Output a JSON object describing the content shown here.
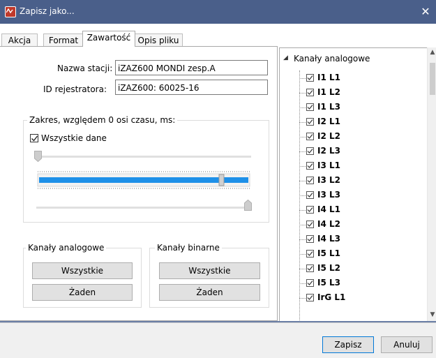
{
  "window": {
    "title": "Zapisz jako...",
    "close_glyph": "✕"
  },
  "tabs": [
    {
      "label": "Akcja"
    },
    {
      "label": "Format"
    },
    {
      "label": "Zawartość",
      "active": true
    },
    {
      "label": "Opis pliku"
    }
  ],
  "station": {
    "name_label": "Nazwa stacji:",
    "name_value": "iZAZ600 MONDI zesp.A",
    "recorder_label": "ID rejestratora:",
    "recorder_value": "iZAZ600: 60025-16"
  },
  "range": {
    "title": "Zakres, względem 0 osi czasu, ms:",
    "all_data_label": "Wszystkie dane",
    "all_data_checked": true
  },
  "analog_group": {
    "title": "Kanały analogowe",
    "all_button": "Wszystkie",
    "none_button": "Żaden"
  },
  "binary_group": {
    "title": "Kanały binarne",
    "all_button": "Wszystkie",
    "none_button": "Żaden"
  },
  "tree": {
    "root_label": "Kanały analogowe",
    "expander_glyph": "◢",
    "items": [
      {
        "label": "I1 L1",
        "checked": true
      },
      {
        "label": "I1 L2",
        "checked": true
      },
      {
        "label": "I1 L3",
        "checked": true
      },
      {
        "label": "I2 L1",
        "checked": true
      },
      {
        "label": "I2 L2",
        "checked": true
      },
      {
        "label": "I2 L3",
        "checked": true
      },
      {
        "label": "I3 L1",
        "checked": true
      },
      {
        "label": "I3 L2",
        "checked": true
      },
      {
        "label": "I3 L3",
        "checked": true
      },
      {
        "label": "I4 L1",
        "checked": true
      },
      {
        "label": "I4 L2",
        "checked": true
      },
      {
        "label": "I4 L3",
        "checked": true
      },
      {
        "label": "I5 L1",
        "checked": true
      },
      {
        "label": "I5 L2",
        "checked": true
      },
      {
        "label": "I5 L3",
        "checked": true
      },
      {
        "label": "IrG L1",
        "checked": true
      }
    ]
  },
  "footer": {
    "save_button": "Zapisz",
    "cancel_button": "Anuluj"
  },
  "colors": {
    "titlebar": "#4a5f8a",
    "range_bar": "#1e90e8",
    "accent_border": "#0078d7"
  }
}
